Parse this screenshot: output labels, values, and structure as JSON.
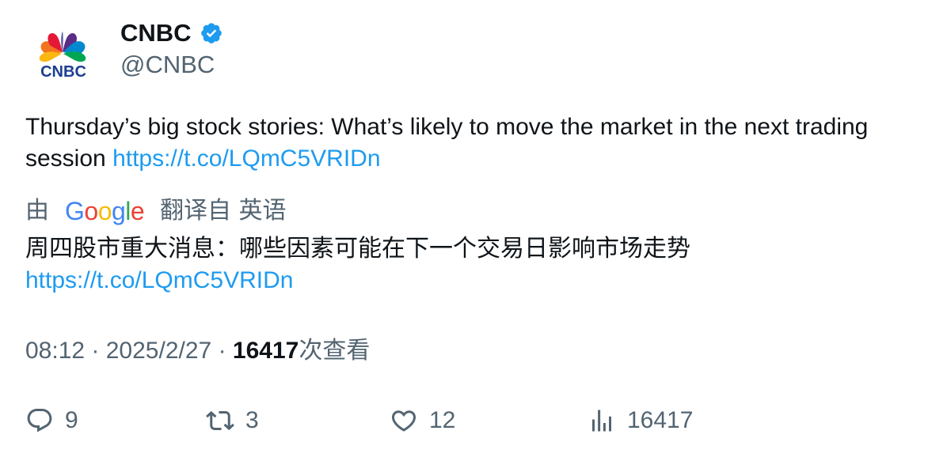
{
  "author": {
    "name": "CNBC",
    "handle": "@CNBC",
    "avatar_icon": "cnbc-peacock-logo",
    "avatar_text": "CNBC",
    "verified_icon": "verified-badge-icon",
    "verified_color": "#1d9bf0"
  },
  "tweet": {
    "text": "Thursday’s big stock stories: What’s likely to move the market in the next trading session",
    "link": "https://t.co/LQmC5VRIDn"
  },
  "translation": {
    "prefix": "由",
    "provider": "Google",
    "suffix": "翻译自 英语",
    "text": "周四股市重大消息：哪些因素可能在下一个交易日影响市场走势",
    "link": "https://t.co/LQmC5VRIDn"
  },
  "meta": {
    "time": "08:12",
    "separator": "·",
    "date": "2025/2/27",
    "views_count": "16417",
    "views_label": "次查看"
  },
  "actions": {
    "reply": {
      "icon": "reply-icon",
      "count": "9"
    },
    "retweet": {
      "icon": "retweet-icon",
      "count": "3"
    },
    "like": {
      "icon": "like-icon",
      "count": "12"
    },
    "views": {
      "icon": "views-icon",
      "count": "16417"
    }
  },
  "colors": {
    "link": "#1d9bf0",
    "secondary_text": "#536471",
    "primary_text": "#0f1419"
  }
}
